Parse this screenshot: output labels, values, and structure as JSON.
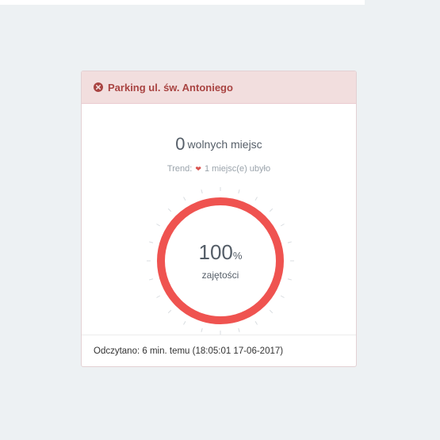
{
  "header": {
    "title": "Parking ul. św. Antoniego",
    "icon": "close-circle-icon",
    "color": "#a94442",
    "background": "#f2dede"
  },
  "availability": {
    "free_count": "0",
    "free_label": "wolnych miejsc"
  },
  "trend": {
    "label": "Trend:",
    "icon": "heart-icon",
    "text": "1 miejsc(e) ubyło"
  },
  "occupancy": {
    "value": "100",
    "unit": "%",
    "label": "zajętości",
    "fraction": 1.0,
    "color": "#ef5350"
  },
  "footer": {
    "text": "Odczytano: 6 min. temu (18:05:01 17-06-2017)"
  }
}
